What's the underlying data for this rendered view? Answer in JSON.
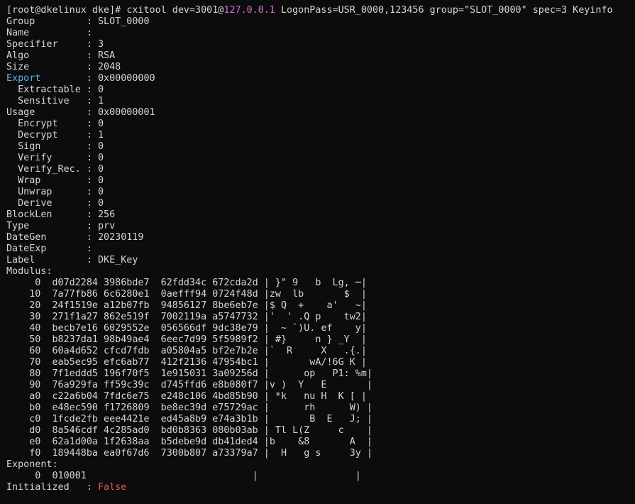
{
  "colors": {
    "background": "#0c0c0c",
    "text": "#d6d6d6",
    "ip_highlight": "#d36fd3",
    "export_label": "#5fb7e6",
    "false_value": "#e05a5a"
  },
  "command": {
    "prompt": "[root@dkelinux dke]# ",
    "before_ip": "cxitool dev=3001@",
    "ip": "127.0.0.1",
    "after_ip": " LogonPass=USR_0000,123456 group=\"SLOT_0000\" spec=3 Keyinfo"
  },
  "fields": [
    "Group         : SLOT_0000",
    "Name          :",
    "Specifier     : 3",
    "Algo          : RSA",
    "Size          : 2048"
  ],
  "export": {
    "label": "Export",
    "rest": "        : 0x00000000"
  },
  "fields2": [
    "  Extractable : 0",
    "  Sensitive   : 1",
    "Usage         : 0x00000001",
    "  Encrypt     : 0",
    "  Decrypt     : 1",
    "  Sign        : 0",
    "  Verify      : 0",
    "  Verify_Rec. : 0",
    "  Wrap        : 0",
    "  Unwrap      : 0",
    "  Derive      : 0",
    "BlockLen      : 256",
    "Type          : prv",
    "DateGen       : 20230119",
    "DateExp       :",
    "Label         : DKE_Key",
    "Modulus:"
  ],
  "modulus_rows": [
    "     0  d07d2284 3986bde7  62fdd34c 672cda2d | }\" 9   b  Lg, ─|",
    "    10  7a77fb86 6c6280e1  0aefff94 0724f48d |zw  lb       $  |",
    "    20  24f1519e a12b07fb  94856127 8be6eb7e |$ Q  +    a'   ~|",
    "    30  271f1a27 862e519f  7002119a a5747732 |'  ' .Q p    tw2|",
    "    40  becb7e16 6029552e  056566df 9dc38e79 |  ~ `)U. ef    y|",
    "    50  b8237da1 98b49ae4  6eec7d99 5f5989f2 | #}     n } _Y  |",
    "    60  60a4d652 cfcd7fdb  a05804a5 bf2e7b2e |`  R     X   .{.|",
    "    70  eab5ec95 efc6ab77  412f2136 47954bc1 |       wA/!6G K |",
    "    80  7f1eddd5 196f70f5  1e915031 3a09256d |      op   P1: %m|",
    "    90  76a929fa ff59c39c  d745ffd6 e8b080f7 |v )  Y   E       |",
    "    a0  c22a6b04 7fdc6e75  e248c106 4bd85b90 | *k   nu H  K [ |",
    "    b0  e48ec590 f1726809  be8ec39d e75729ac |      rh      W) |",
    "    c0  1fcde2fb eee4421e  ed45a8b9 e74a3b1b |       B  E   J; |",
    "    d0  8a546cdf 4c285ad0  bd0b8363 080b03ab | Tl L(Z     c    |",
    "    e0  62a1d00a 1f2638aa  b5debe9d db41ded4 |b    &8       A  |",
    "    f0  189448ba ea0f67d6  7300b807 a73379a7 |  H   g s     3y |"
  ],
  "exponent": {
    "label": "Exponent:",
    "row": "     0  010001                             |                 |"
  },
  "initialized": {
    "label": "Initialized   : ",
    "value": "False"
  }
}
